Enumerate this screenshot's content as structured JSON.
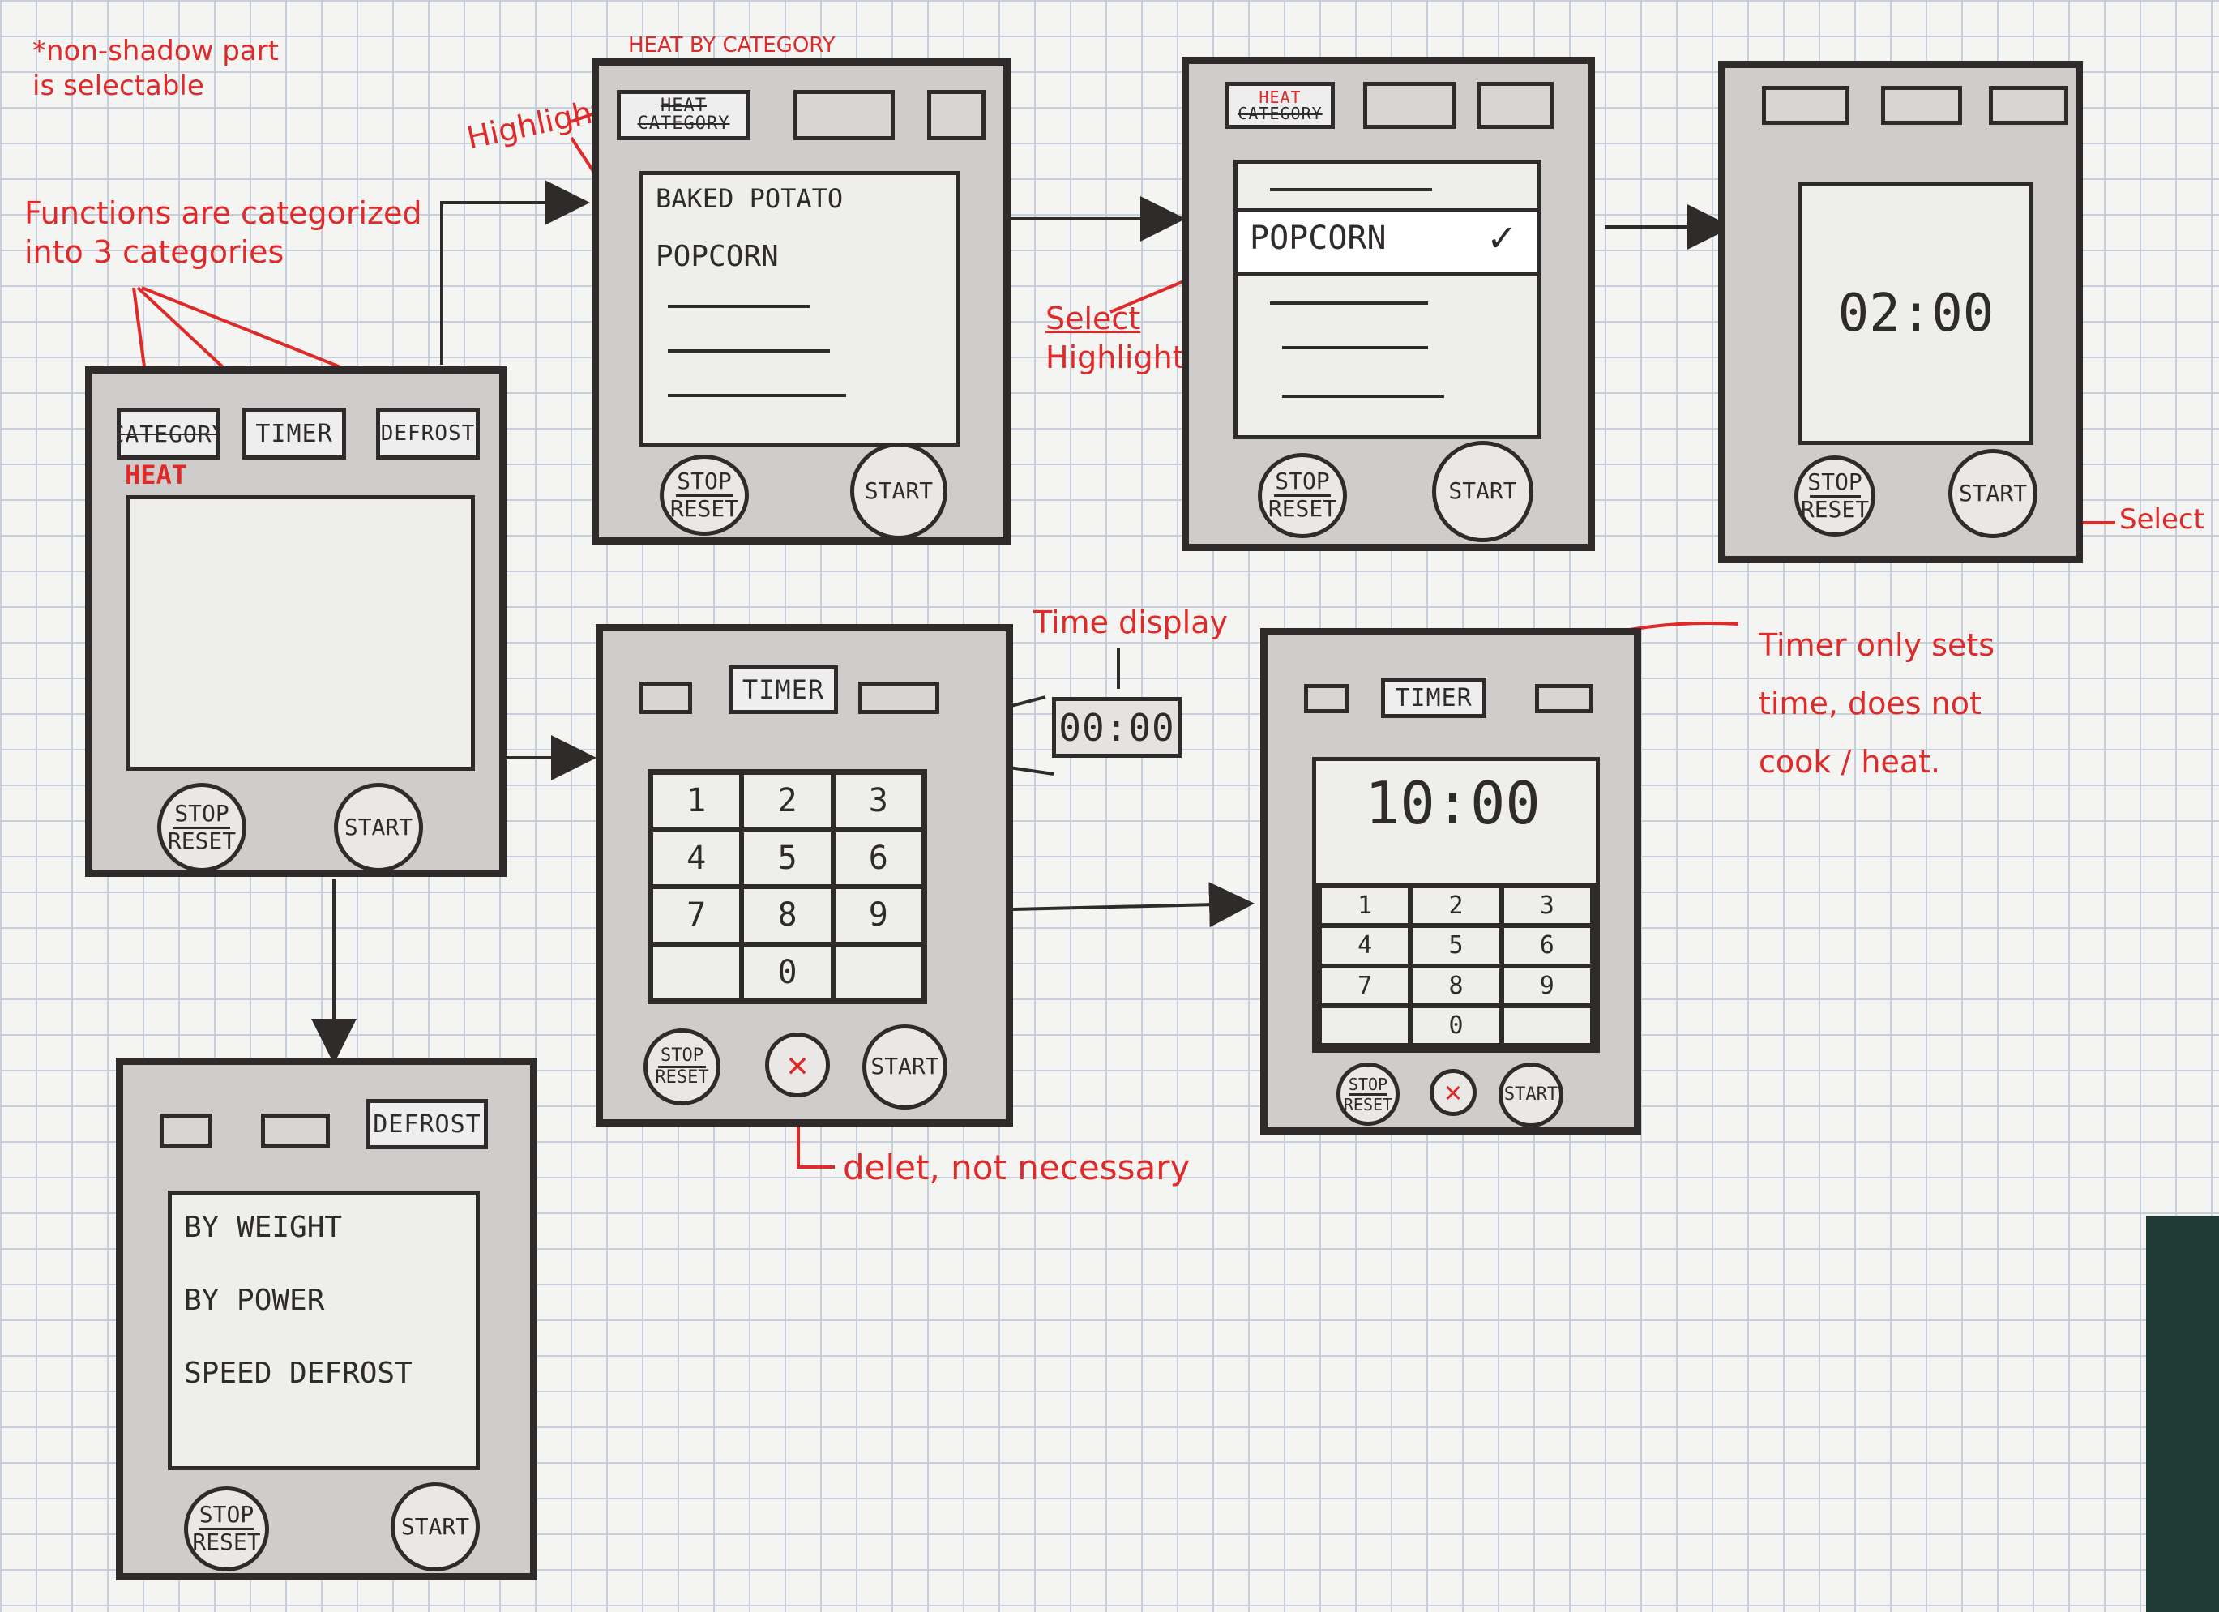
{
  "annotations": {
    "selectable_note": [
      "*non-shadow part",
      "is selectable"
    ],
    "categories_note": [
      "Functions are categorized",
      "into 3 categories"
    ],
    "highlight": "Highlight",
    "select_highlight": [
      "Select",
      "Highlight"
    ],
    "select": "Select",
    "time_display": "Time display",
    "timer_note": [
      "Timer only sets",
      "time, does not",
      "cook / heat."
    ],
    "delete_note": "delet, not necessary"
  },
  "home_screen": {
    "tabs": [
      "CATEGORY",
      "TIMER",
      "DEFROST"
    ],
    "heat_label": "HEAT",
    "stop_label": "STOP",
    "reset_label": "RESET",
    "start_label": "START"
  },
  "heat_list_screen": {
    "top_label": "HEAT BY CATEGORY",
    "tab_heat": "HEAT",
    "tab_category": "CATEGORY",
    "items": [
      "BAKED POTATO",
      "POPCORN"
    ],
    "stop_label": "STOP",
    "reset_label": "RESET",
    "start_label": "START"
  },
  "heat_select_screen": {
    "tab_heat": "HEAT",
    "tab_category": "CATEGORY",
    "selected_item": "POPCORN",
    "checkmark": "✓",
    "stop_label": "STOP",
    "reset_label": "RESET",
    "start_label": "START"
  },
  "cook_screen": {
    "time": "02:00",
    "stop_label": "STOP",
    "reset_label": "RESET",
    "start_label": "START"
  },
  "timer_entry_screen": {
    "tab": "TIMER",
    "keys": [
      "1",
      "2",
      "3",
      "4",
      "5",
      "6",
      "7",
      "8",
      "9",
      "",
      "0",
      ""
    ],
    "small_display": "00:00",
    "stop_label": "STOP",
    "reset_label": "RESET",
    "start_label": "START"
  },
  "timer_run_screen": {
    "tab": "TIMER",
    "time": "10:00",
    "keys": [
      "1",
      "2",
      "3",
      "4",
      "5",
      "6",
      "7",
      "8",
      "9",
      "",
      "0",
      ""
    ],
    "stop_label": "STOP",
    "reset_label": "RESET",
    "start_label": "START"
  },
  "defrost_screen": {
    "tab": "DEFROST",
    "items": [
      "BY WEIGHT",
      "BY POWER",
      "SPEED DEFROST"
    ],
    "stop_label": "STOP",
    "reset_label": "RESET",
    "start_label": "START"
  }
}
